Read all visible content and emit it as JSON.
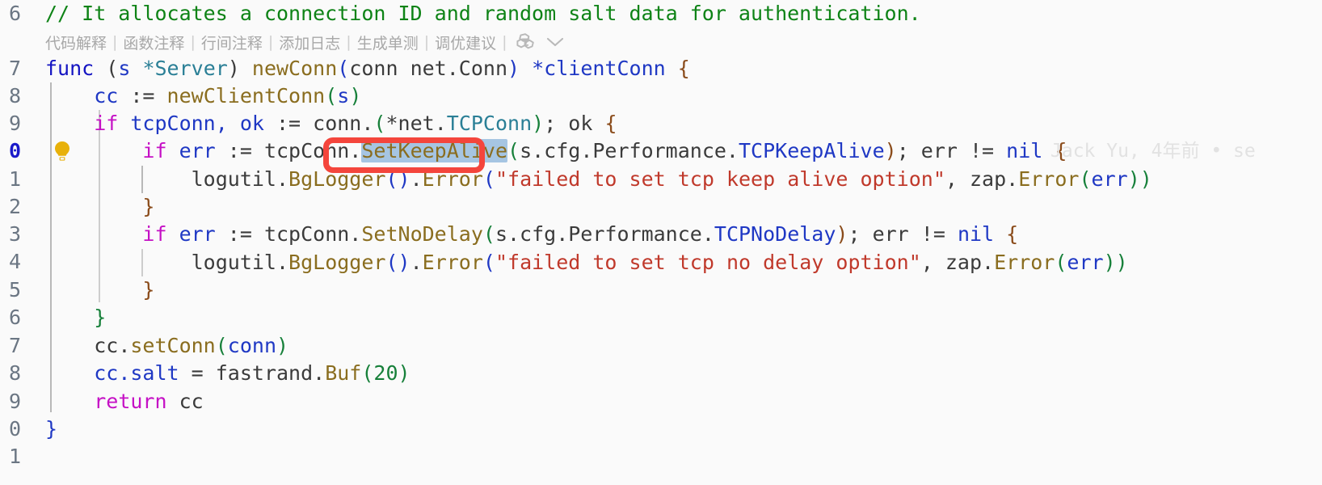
{
  "editor": {
    "background": "#fafafa",
    "language": "go",
    "current_line_number": "0",
    "gutter_line_numbers": [
      "6",
      "7",
      "8",
      "9",
      "0",
      "1",
      "2",
      "3",
      "4",
      "5",
      "6",
      "7",
      "8",
      "9",
      "0",
      "1"
    ]
  },
  "ai_toolbar": {
    "items": [
      {
        "label": "代码解释"
      },
      {
        "label": "函数注释"
      },
      {
        "label": "行间注释"
      },
      {
        "label": "添加日志"
      },
      {
        "label": "生成单测"
      },
      {
        "label": "调优建议"
      }
    ],
    "separator": "|",
    "logo_icon": "ai-assistant-logo-icon",
    "chevron_icon": "chevron-down-icon"
  },
  "gutter": {
    "bulb_icon": "lightbulb-intention-icon"
  },
  "blame": {
    "text": "Jack Yu, 4年前 • se"
  },
  "annotation": {
    "color": "#f4453c",
    "target": "SetKeepAlive"
  },
  "selection": {
    "text": "SetKeepAlive",
    "background": "#a6c5e2"
  },
  "code_lines": {
    "l6": {
      "comment": "// It allocates a connection ID and random salt data for authentication."
    },
    "l7": {
      "kw_func": "func",
      "p1": " (",
      "recv_name": "s ",
      "recv_type": "*Server",
      "p2": ") ",
      "fn_name": "newConn",
      "p3": "(",
      "arg": "conn net.Conn",
      "p4": ") ",
      "ret": "*clientConn",
      "brace": " {"
    },
    "l8": {
      "indent": "    ",
      "var": "cc",
      "op": " := ",
      "fn_name": "newClientConn",
      "p1": "(",
      "arg": "s",
      "p2": ")"
    },
    "l9": {
      "indent": "    ",
      "kw_if": "if",
      "vars": " tcpConn, ok ",
      "op": ":= ",
      "recv": "conn.",
      "p1": "(",
      "star": "*",
      "pkg": "net.",
      "typ": "TCPConn",
      "p2": ")",
      "semi": "; ",
      "ok": "ok ",
      "brace": "{"
    },
    "l10": {
      "indent": "        ",
      "kw_if": "if",
      "err": " err ",
      "op": ":= ",
      "recv": "tcpConn.",
      "method": "SetKeepAlive",
      "p1": "(",
      "arg": "s.cfg.Performance.",
      "field": "TCPKeepAlive",
      "p2": ")",
      "semi": "; ",
      "cond": "err != ",
      "nil": "nil",
      "brace": " {"
    },
    "l11": {
      "indent": "            ",
      "pkg": "logutil.",
      "fn1": "BgLogger",
      "p1": "()",
      "dot": ".",
      "fn2": "Error",
      "p2": "(",
      "str": "\"failed to set tcp keep alive option\"",
      "comma": ", ",
      "pkg2": "zap.",
      "fn3": "Error",
      "p3": "(",
      "arg": "err",
      "p4": "))"
    },
    "l12": {
      "indent": "        ",
      "brace": "}"
    },
    "l13": {
      "indent": "        ",
      "kw_if": "if",
      "err": " err ",
      "op": ":= ",
      "recv": "tcpConn.",
      "method": "SetNoDelay",
      "p1": "(",
      "arg": "s.cfg.Performance.",
      "field": "TCPNoDelay",
      "p2": ")",
      "semi": "; ",
      "cond": "err != ",
      "nil": "nil",
      "brace": " {"
    },
    "l14": {
      "indent": "            ",
      "pkg": "logutil.",
      "fn1": "BgLogger",
      "p1": "()",
      "dot": ".",
      "fn2": "Error",
      "p2": "(",
      "str": "\"failed to set tcp no delay option\"",
      "comma": ", ",
      "pkg2": "zap.",
      "fn3": "Error",
      "p3": "(",
      "arg": "err",
      "p4": "))"
    },
    "l15": {
      "indent": "        ",
      "brace": "}"
    },
    "l16": {
      "indent": "    ",
      "brace": "}"
    },
    "l17": {
      "indent": "    ",
      "recv": "cc.",
      "method": "setConn",
      "p1": "(",
      "arg": "conn",
      "p2": ")"
    },
    "l18": {
      "indent": "    ",
      "field": "cc.salt",
      "op": " = ",
      "pkg": "fastrand.",
      "fn": "Buf",
      "p1": "(",
      "num": "20",
      "p2": ")"
    },
    "l19": {
      "indent": "    ",
      "kw_return": "return",
      "val": " cc"
    },
    "l20": {
      "brace": "}"
    }
  }
}
